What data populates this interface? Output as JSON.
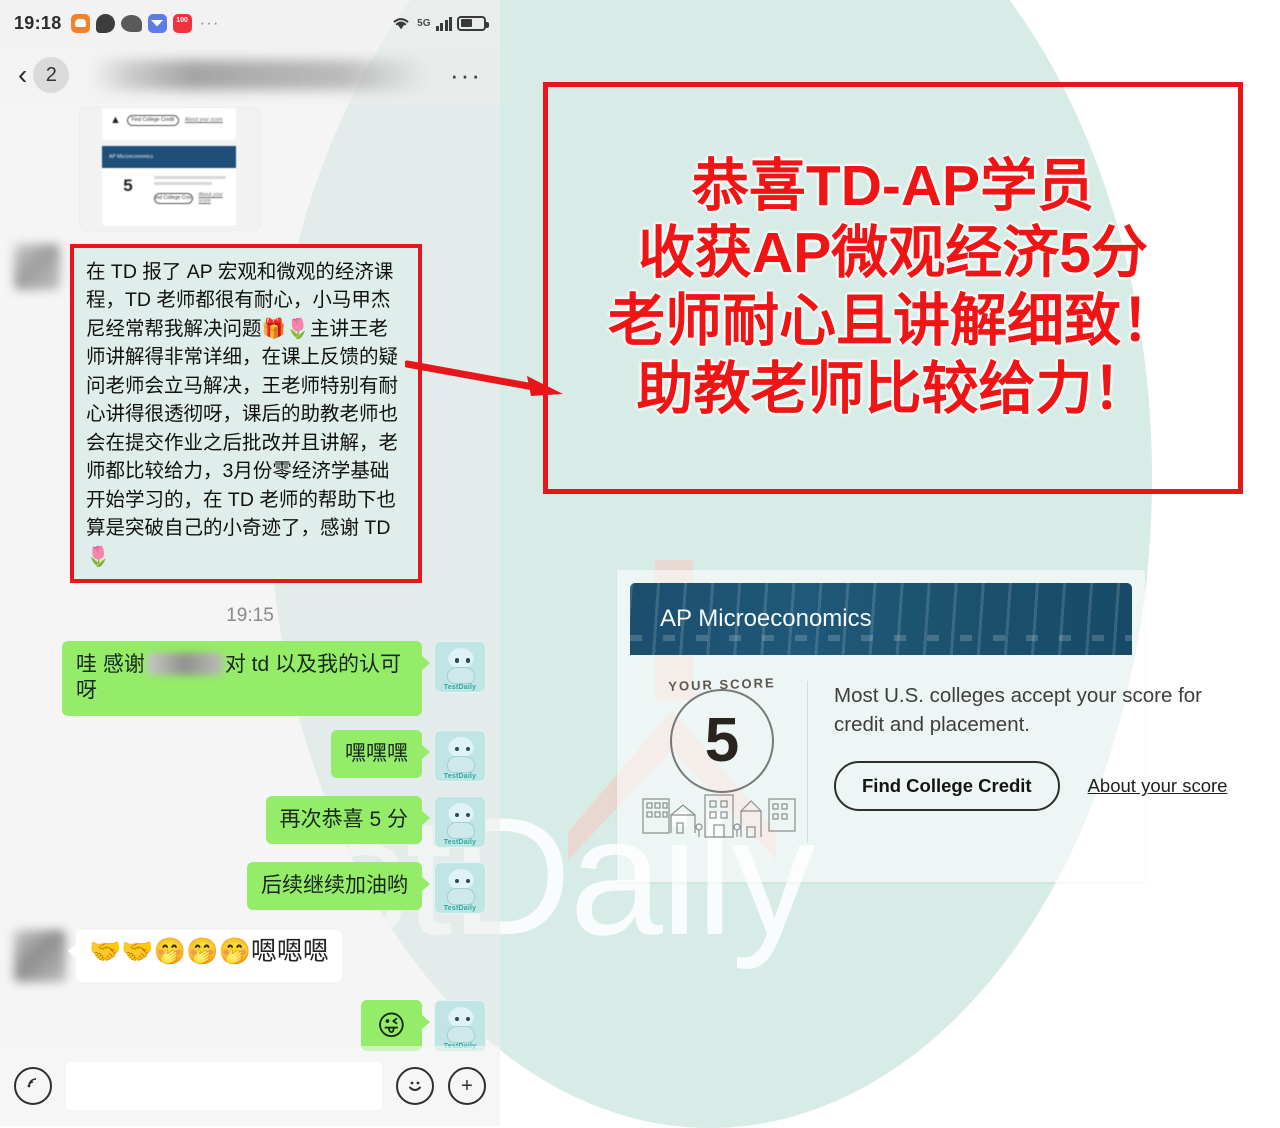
{
  "statusbar": {
    "time": "19:18",
    "network": "5G",
    "app_icons": [
      "mail-icon",
      "chat-bubble-icon",
      "wechat-icon",
      "envelope-icon",
      "hundred-icon"
    ],
    "overflow": "···",
    "wifi_icon": "wifi-icon",
    "signal_icon": "cellular-signal-icon",
    "battery_icon": "battery-icon"
  },
  "navbar": {
    "back_badge": "2",
    "title": "",
    "more": "···"
  },
  "chat": {
    "timestamp": "19:15",
    "received_highlight": "在 TD 报了 AP 宏观和微观的经济课程，TD 老师都很有耐心，小马甲杰尼经常帮我解决问题🎁🌷主讲王老师讲解得非常详细，在课上反馈的疑问老师会立马解决，王老师特别有耐心讲得很透彻呀，课后的助教老师也会在提交作业之后批改并且讲解，老师都比较给力，3月份零经济学基础开始学习的，在 TD 老师的帮助下也算是突破自己的小奇迹了，感谢 TD🌷",
    "sent_messages": [
      {
        "pre": "哇 感谢",
        "post": "对 td 以及我的认可呀",
        "has_blur_name": true
      },
      {
        "pre": "嘿嘿嘿",
        "post": "",
        "has_blur_name": false
      },
      {
        "pre": "再次恭喜 5 分",
        "post": "",
        "has_blur_name": false
      },
      {
        "pre": "后续继续加油哟",
        "post": "",
        "has_blur_name": false
      }
    ],
    "received_emoji_message": "🤝🤝🤭🤭🤭嗯嗯嗯",
    "sent_emoji_message": "😜",
    "avatar_tag": "TestDaily"
  },
  "inputbar": {
    "voice_icon": "voice-wave-icon",
    "text_value": "",
    "emoji_icon": "smiley-face-icon",
    "plus_icon": "plus-circle-icon"
  },
  "banner": {
    "lines": [
      "恭喜TD-AP学员",
      "收获AP微观经济5分",
      "老师耐心且讲解细致！",
      "助教老师比较给力！"
    ],
    "border_color": "#e8161a",
    "text_color": "#f01414"
  },
  "score_card": {
    "band_title": "AP Microeconomics",
    "score_label": "YOUR SCORE",
    "score": "5",
    "description": "Most U.S. colleges accept your score for credit and placement.",
    "primary_button": "Find College Credit",
    "secondary_link": "About your score"
  },
  "watermark": {
    "text": "TestDaily"
  },
  "colors": {
    "bg_circle": "#d7ece6",
    "sent_bubble": "#95ec69",
    "received_highlight_bg": "#dfeeea",
    "card_band": "#1c4e6e",
    "accent_red": "#e8161a"
  }
}
